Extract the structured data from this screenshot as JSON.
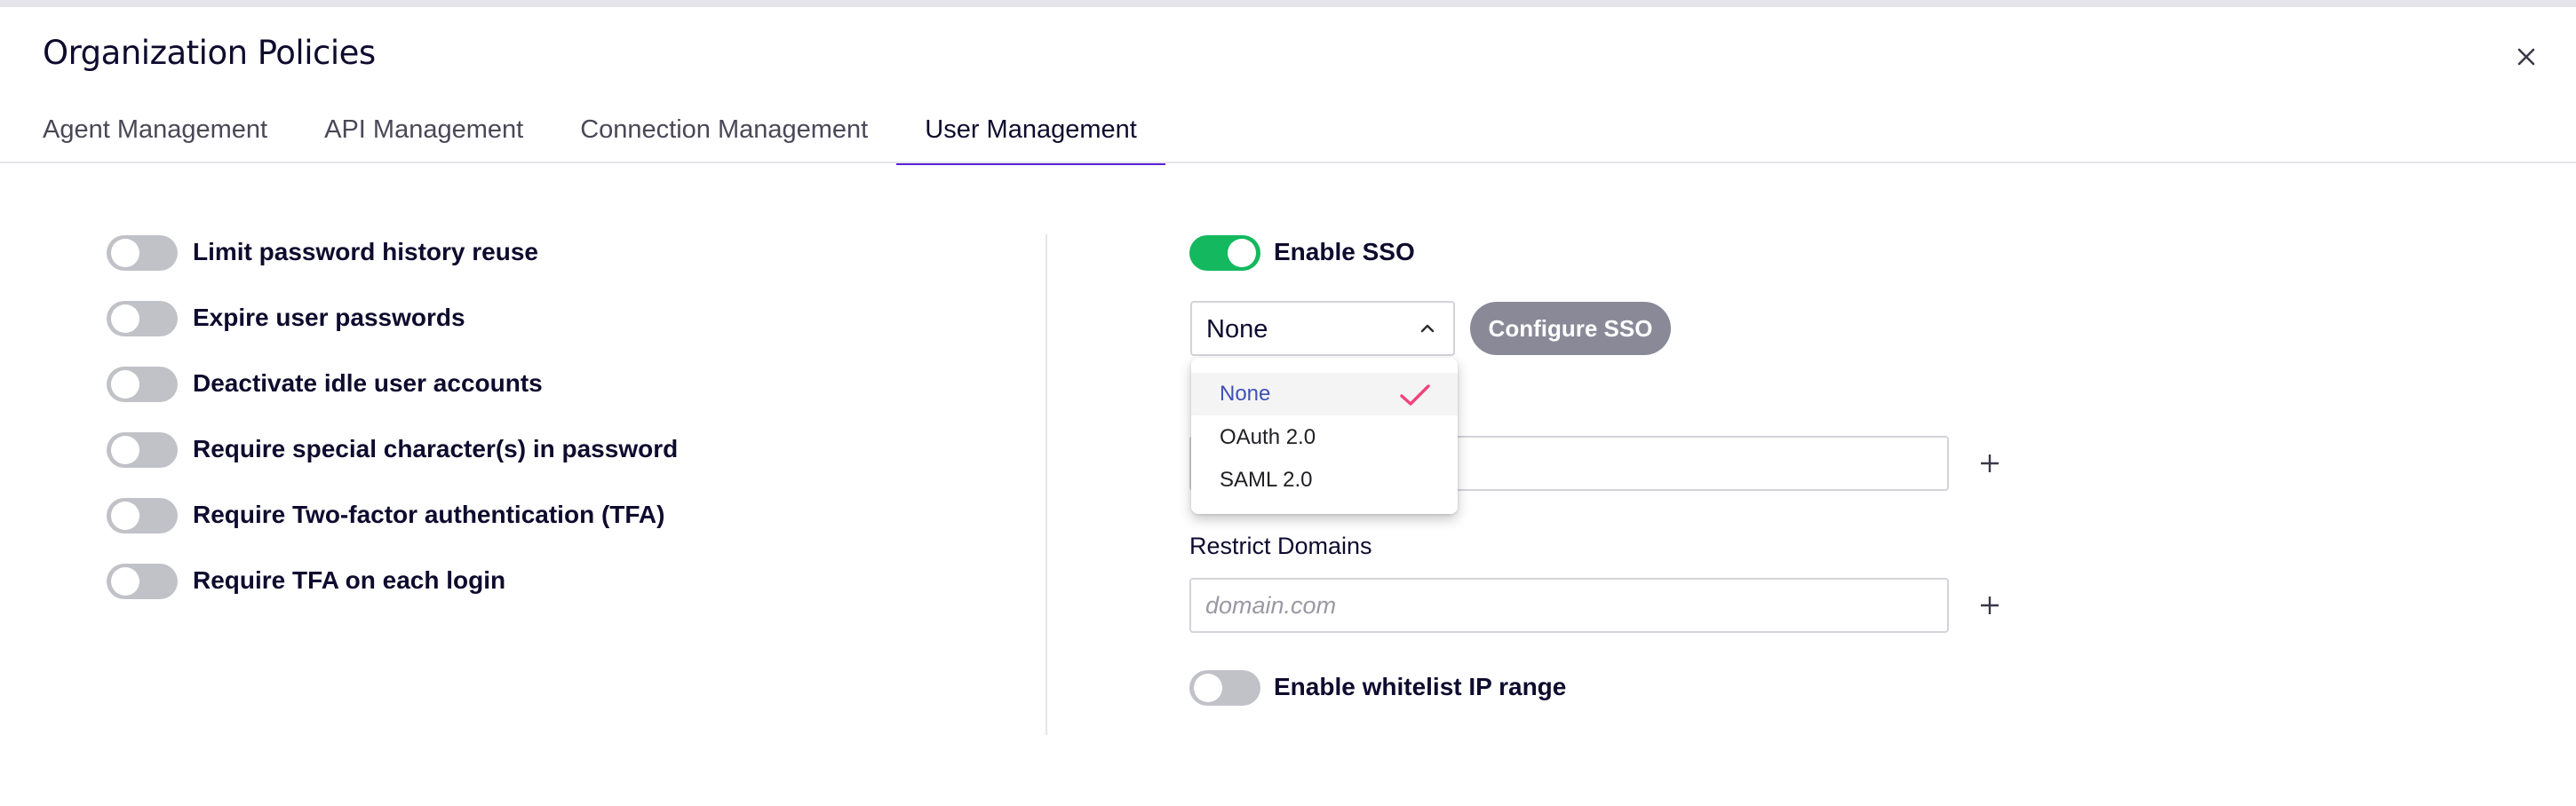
{
  "dialog": {
    "title": "Organization Policies",
    "close_icon": "close-icon"
  },
  "tabs": [
    {
      "label": "Agent Management",
      "active": false
    },
    {
      "label": "API Management",
      "active": false
    },
    {
      "label": "Connection Management",
      "active": false
    },
    {
      "label": "User Management",
      "active": true
    }
  ],
  "colors": {
    "accent": "#5b22d8",
    "toggle_on": "#13b85f",
    "toggle_off": "#c1c1c8",
    "button_disabled": "#8a8997",
    "selected_option": "#3f51b5",
    "checkmark": "#f0437a"
  },
  "left_policies": [
    {
      "label": "Limit password history reuse",
      "enabled": false
    },
    {
      "label": "Expire user passwords",
      "enabled": false
    },
    {
      "label": "Deactivate idle user accounts",
      "enabled": false
    },
    {
      "label": "Require special character(s) in password",
      "enabled": false
    },
    {
      "label": "Require Two-factor authentication (TFA)",
      "enabled": false
    },
    {
      "label": "Require TFA on each login",
      "enabled": false
    }
  ],
  "sso": {
    "toggle_label": "Enable SSO",
    "enabled": true,
    "select_value": "None",
    "select_icon": "chevron-up-icon",
    "configure_label": "Configure SSO",
    "options": [
      {
        "label": "None",
        "selected": true
      },
      {
        "label": "OAuth 2.0",
        "selected": false
      },
      {
        "label": "SAML 2.0",
        "selected": false
      }
    ],
    "check_icon": "checkmark-icon"
  },
  "first_input": {
    "value": "",
    "add_icon": "plus-icon"
  },
  "restrict_domains": {
    "label": "Restrict Domains",
    "placeholder": "domain.com",
    "value": "",
    "add_icon": "plus-icon"
  },
  "whitelist": {
    "label": "Enable whitelist IP range",
    "enabled": false
  }
}
